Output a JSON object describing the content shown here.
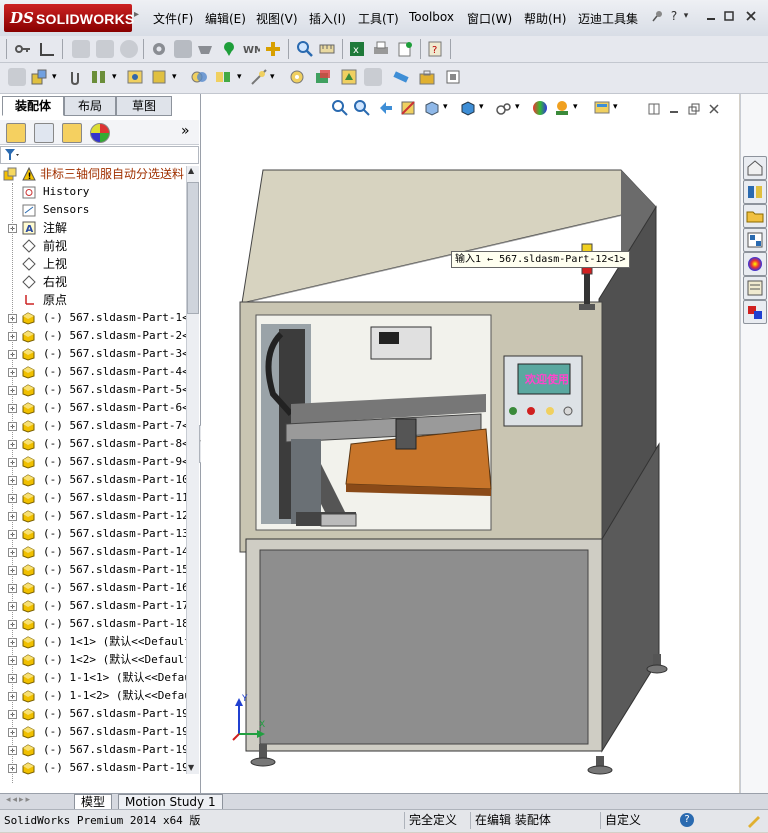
{
  "app": {
    "logo_ds": "DS",
    "logo_text": "SOLIDWORKS",
    "help_mark": "?"
  },
  "menu": [
    {
      "label": "文件(F)"
    },
    {
      "label": "编辑(E)"
    },
    {
      "label": "视图(V)"
    },
    {
      "label": "插入(I)"
    },
    {
      "label": "工具(T)"
    },
    {
      "label": "Toolbox"
    },
    {
      "label": "窗口(W)"
    },
    {
      "label": "帮助(H)"
    },
    {
      "label": "迈迪工具集"
    }
  ],
  "panel": {
    "tabs": [
      "装配体",
      "布局",
      "草图"
    ],
    "collapse_glyph": "»",
    "filter_icon": "filter-icon",
    "root_label": "非标三轴伺服自动分选送料",
    "items": [
      {
        "label": "History",
        "icon": "history-icon",
        "expand": false,
        "cn": false
      },
      {
        "label": "Sensors",
        "icon": "sensors-icon",
        "expand": false,
        "cn": false
      },
      {
        "label": "注解",
        "icon": "annotation-icon",
        "expand": true,
        "cn": true
      },
      {
        "label": "前视",
        "icon": "plane-icon",
        "expand": false,
        "cn": true
      },
      {
        "label": "上视",
        "icon": "plane-icon",
        "expand": false,
        "cn": true
      },
      {
        "label": "右视",
        "icon": "plane-icon",
        "expand": false,
        "cn": true
      },
      {
        "label": "原点",
        "icon": "origin-icon",
        "expand": false,
        "cn": true
      },
      {
        "label": "(-) 567.sldasm-Part-1<1",
        "icon": "part-icon",
        "expand": true
      },
      {
        "label": "(-) 567.sldasm-Part-2<1",
        "icon": "part-icon",
        "expand": true
      },
      {
        "label": "(-) 567.sldasm-Part-3<1",
        "icon": "part-icon",
        "expand": true
      },
      {
        "label": "(-) 567.sldasm-Part-4<1",
        "icon": "part-icon",
        "expand": true
      },
      {
        "label": "(-) 567.sldasm-Part-5<1",
        "icon": "part-icon",
        "expand": true
      },
      {
        "label": "(-) 567.sldasm-Part-6<1",
        "icon": "part-icon",
        "expand": true
      },
      {
        "label": "(-) 567.sldasm-Part-7<1",
        "icon": "part-icon",
        "expand": true
      },
      {
        "label": "(-) 567.sldasm-Part-8<1",
        "icon": "part-icon",
        "expand": true
      },
      {
        "label": "(-) 567.sldasm-Part-9<1",
        "icon": "part-icon",
        "expand": true
      },
      {
        "label": "(-) 567.sldasm-Part-10<",
        "icon": "part-icon",
        "expand": true
      },
      {
        "label": "(-) 567.sldasm-Part-11<",
        "icon": "part-icon",
        "expand": true
      },
      {
        "label": "(-) 567.sldasm-Part-12<",
        "icon": "part-icon",
        "expand": true
      },
      {
        "label": "(-) 567.sldasm-Part-13<",
        "icon": "part-icon",
        "expand": true
      },
      {
        "label": "(-) 567.sldasm-Part-14<",
        "icon": "part-icon",
        "expand": true
      },
      {
        "label": "(-) 567.sldasm-Part-15<",
        "icon": "part-icon",
        "expand": true
      },
      {
        "label": "(-) 567.sldasm-Part-16<",
        "icon": "part-icon",
        "expand": true
      },
      {
        "label": "(-) 567.sldasm-Part-17<",
        "icon": "part-icon",
        "expand": true
      },
      {
        "label": "(-) 567.sldasm-Part-18<",
        "icon": "part-icon",
        "expand": true
      },
      {
        "label": "(-) 1<1> (默认<<Default",
        "icon": "part-icon",
        "expand": true
      },
      {
        "label": "(-) 1<2> (默认<<Default",
        "icon": "part-icon",
        "expand": true
      },
      {
        "label": "(-) 1-1<1> (默认<<Defau",
        "icon": "part-icon",
        "expand": true
      },
      {
        "label": "(-) 1-1<2> (默认<<Defau",
        "icon": "part-icon",
        "expand": true
      },
      {
        "label": "(-) 567.sldasm-Part-19<",
        "icon": "part-icon",
        "expand": true
      },
      {
        "label": "(-) 567.sldasm-Part-19<",
        "icon": "part-icon",
        "expand": true
      },
      {
        "label": "(-) 567.sldasm-Part-19<",
        "icon": "part-icon",
        "expand": true
      },
      {
        "label": "(-) 567.sldasm-Part-19<",
        "icon": "part-icon",
        "expand": true
      }
    ]
  },
  "viewport": {
    "tooltip": "输入1 ← 567.sldasm-Part-12<1>",
    "hmi_screen_text": "欢迎使用",
    "triad": {
      "x": "X",
      "y": "Y",
      "z": "Z"
    }
  },
  "bottom_tabs": [
    "模型",
    "Motion Study 1"
  ],
  "status": {
    "product": "SolidWorks Premium 2014 x64 版",
    "definition": "完全定义",
    "mode": "在编辑 装配体",
    "units": "自定义",
    "help": "?"
  },
  "colors": {
    "brand_red": "#b01818",
    "machine_frame": "#c9c5b2",
    "machine_dark": "#4a4a4a",
    "plate_orange": "#c8752a"
  }
}
